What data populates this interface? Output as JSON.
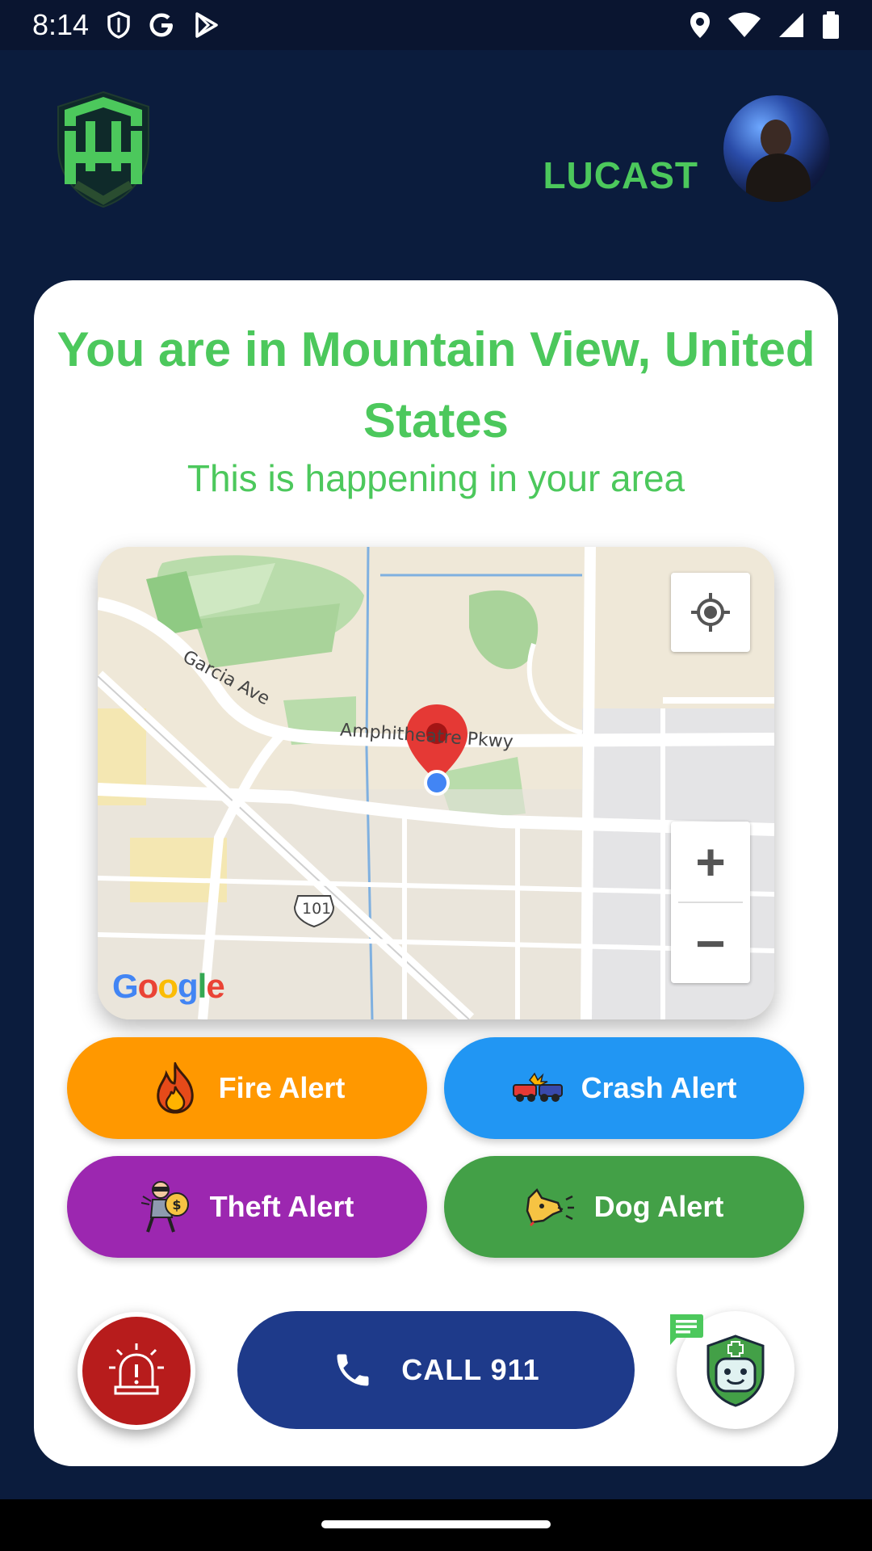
{
  "status_bar": {
    "time": "8:14",
    "left_icons": [
      "shield-icon",
      "google-icon",
      "play-icon"
    ],
    "right_icons": [
      "location-icon",
      "wifi-icon",
      "signal-icon",
      "battery-icon"
    ]
  },
  "header": {
    "username": "LUCAST",
    "brand_color": "#4cc85c"
  },
  "card": {
    "location_title": "You are in Mountain View, United States",
    "subtitle": "This is happening in your area"
  },
  "map": {
    "road_labels": [
      "Garcia Ave",
      "Amphitheatre Pkwy",
      "101"
    ],
    "attribution": "Google",
    "zoom_in": "+",
    "zoom_out": "−"
  },
  "alerts": [
    {
      "label": "Fire Alert",
      "color": "#ff9800",
      "icon": "fire-icon"
    },
    {
      "label": "Crash Alert",
      "color": "#2196f3",
      "icon": "car-crash-icon"
    },
    {
      "label": "Theft Alert",
      "color": "#9c27b0",
      "icon": "thief-icon"
    },
    {
      "label": "Dog Alert",
      "color": "#43a047",
      "icon": "dog-icon"
    }
  ],
  "bottom": {
    "call_label": "CALL 911",
    "siren_icon": "siren-icon",
    "bot_icon": "medic-bot-icon",
    "chat_icon": "chat-icon"
  }
}
